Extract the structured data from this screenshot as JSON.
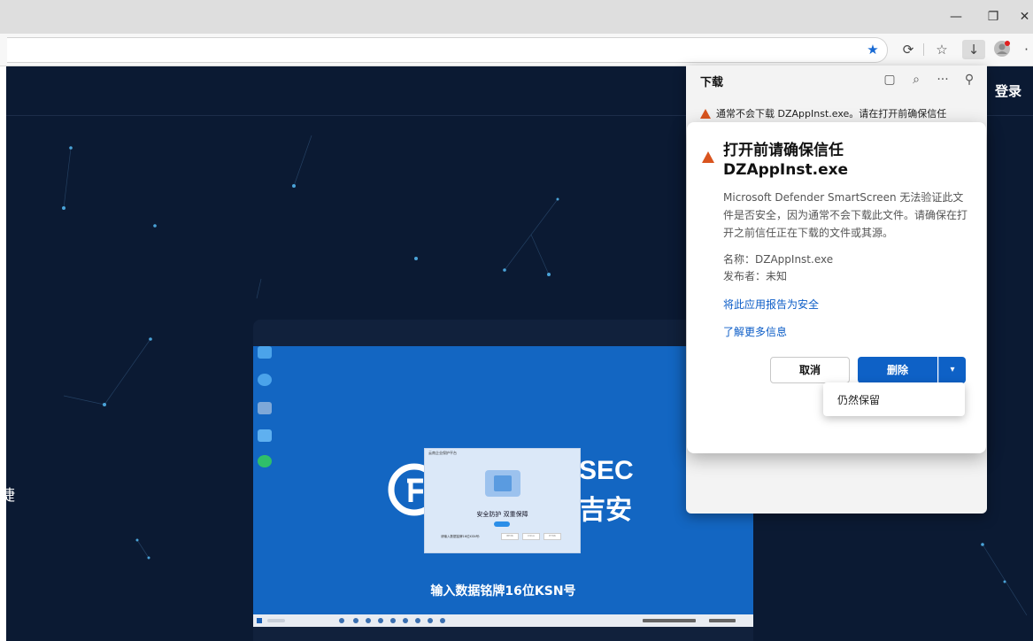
{
  "window": {
    "minimize": "—",
    "restore": "❐",
    "close": "✕"
  },
  "toolbar": {
    "favorite_icon": "★",
    "extensions_icon": "⟳",
    "favorites_icon": "☆",
    "downloads_icon": "↓",
    "more_icon": "·"
  },
  "page": {
    "login": "登录",
    "left_char": "捷",
    "subtitle": "输入数据铭牌16位KSN号"
  },
  "video": {
    "logo_en": "SEC",
    "logo_cn": "吉安",
    "inner_title": "云南企业保护平台",
    "inner_slogan": "安全防护 双重保障",
    "inner_input_label": "请输入数据铭牌16位KSN号:",
    "inner_fields": [
      "8E36",
      "C91A",
      "E796"
    ]
  },
  "download_panel": {
    "title": "下载",
    "tools": [
      "▢",
      "⌕",
      "···",
      "⚲"
    ],
    "warning_row": "通常不会下载 DZAppInst.exe。请在打开前确保信任"
  },
  "dialog": {
    "heading_line1": "打开前请确保信任",
    "heading_line2": "DZAppInst.exe",
    "body": "Microsoft Defender SmartScreen 无法验证此文件是否安全，因为通常不会下载此文件。请确保在打开之前信任正在下载的文件或其源。",
    "name_line": "名称：DZAppInst.exe",
    "publisher_line": "发布者：未知",
    "report_link": "将此应用报告为安全",
    "learn_more_link": "了解更多信息",
    "cancel_label": "取消",
    "delete_label": "删除",
    "keep_label": "仍然保留"
  }
}
